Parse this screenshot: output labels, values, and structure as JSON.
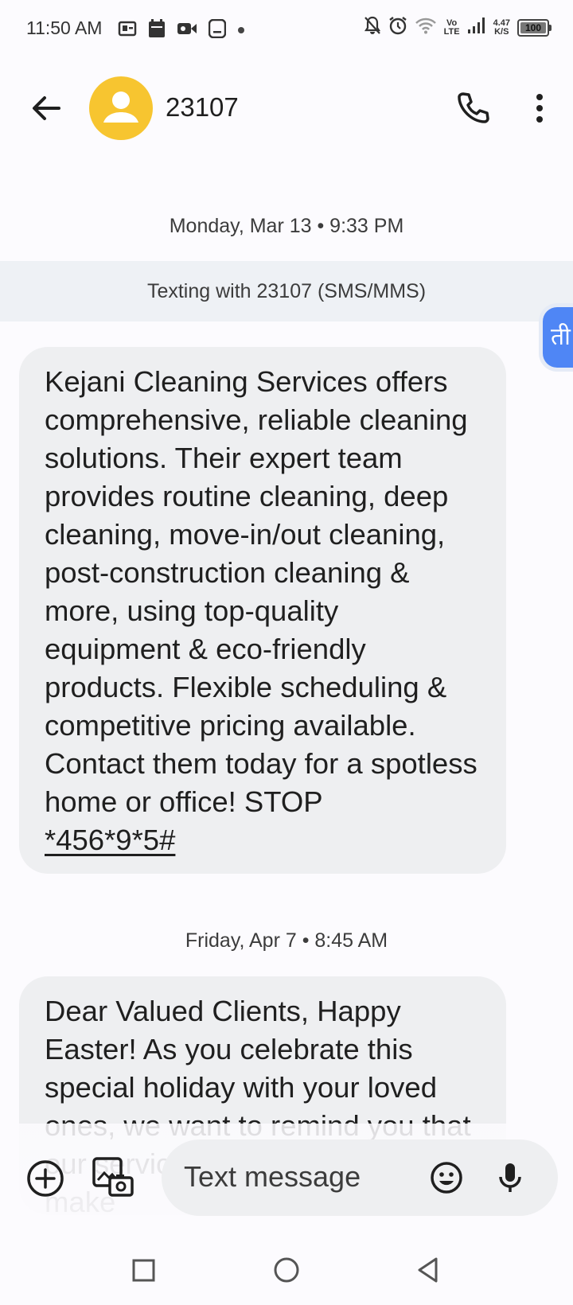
{
  "status_bar": {
    "time": "11:50 AM",
    "net_speed_top": "4.47",
    "net_speed_bottom": "K/S",
    "volte_top": "Vo",
    "volte_bottom": "LTE",
    "battery": "100",
    "left_icons": [
      "sim-card-icon",
      "calendar-icon",
      "video-icon",
      "screen-record-icon",
      "dot-icon"
    ],
    "right_icons": [
      "mute-icon",
      "alarm-icon",
      "wifi-icon",
      "volte-icon",
      "signal-icon",
      "battery-icon"
    ]
  },
  "header": {
    "contact_name": "23107",
    "avatar_icon": "person-icon",
    "back_icon": "arrow-back-icon",
    "call_icon": "phone-icon",
    "menu_icon": "more-vert-icon"
  },
  "conversation": {
    "date_1": "Monday, Mar 13 • 9:33 PM",
    "banner": "Texting with 23107 (SMS/MMS)",
    "translate_badge": "ती",
    "message_1_text": "Kejani Cleaning Services offers comprehensive, reliable cleaning solutions. Their expert team provides routine cleaning, deep cleaning, move-in/out cleaning, post-construction cleaning & more, using top-quality equipment & eco-friendly products. Flexible scheduling & competitive pricing available. Contact them today for a spotless home or office! STOP",
    "message_1_link": "*456*9*5#",
    "date_2": "Friday, Apr 7 • 8:45 AM",
    "message_2_text": "Dear Valued Clients, Happy Easter! As you celebrate this special holiday with your loved ones, we want to remind you that our services are here to help make"
  },
  "compose": {
    "placeholder": "Text message",
    "add_icon": "add-circle-icon",
    "gallery_icon": "gallery-icon",
    "emoji_icon": "emoji-icon",
    "mic_icon": "mic-icon"
  },
  "nav": [
    "recents-icon",
    "home-icon",
    "back-icon"
  ]
}
